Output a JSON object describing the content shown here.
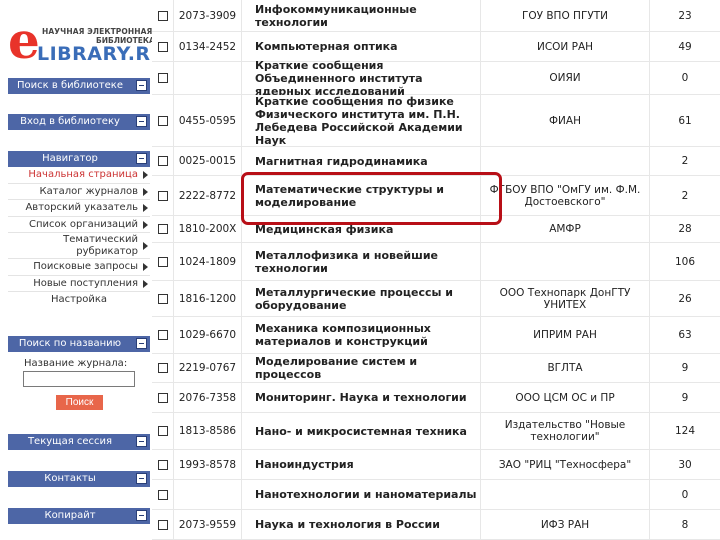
{
  "logo": {
    "line1": "НАУЧНАЯ ЭЛЕКТРОННАЯ",
    "line2": "БИБЛИОТЕКА",
    "main": "LIBRARY.RU",
    "letter": "e",
    "brand_color": "#e8332a",
    "blue": "#3a6db8"
  },
  "sidebar": {
    "search_library": "Поиск в библиотеке",
    "login": "Вход в библиотеку",
    "navigator": "Навигатор",
    "nav_items": [
      {
        "label": "Начальная страница",
        "active": true
      },
      {
        "label": "Каталог журналов",
        "active": false
      },
      {
        "label": "Авторский указатель",
        "active": false
      },
      {
        "label": "Список организаций",
        "active": false
      },
      {
        "label": "Тематический рубрикатор",
        "line1": "Тематический",
        "line2": "рубрикатор",
        "active": false
      },
      {
        "label": "Поисковые запросы",
        "active": false
      },
      {
        "label": "Новые поступления",
        "active": false
      }
    ],
    "settings": "Настройка",
    "search_by_name": "Поиск по названию",
    "journal_name_label": "Название журнала:",
    "journal_name_value": "",
    "search_button": "Поиск",
    "current_session": "Текущая сессия",
    "contacts": "Контакты",
    "kopirait": "Копирайт",
    "panel_color": "#4d66a6",
    "button_color": "#e8664a"
  },
  "journals": [
    {
      "issn": "2073-3909",
      "title": "Инфокоммуникационные технологии",
      "publisher": "ГОУ ВПО ПГУТИ",
      "count": "23"
    },
    {
      "issn": "0134-2452",
      "title": "Компьютерная оптика",
      "publisher": "ИСОИ РАН",
      "count": "49"
    },
    {
      "issn": "",
      "title": "Краткие сообщения Объединенного института ядерных исследований",
      "publisher": "ОИЯИ",
      "count": "0"
    },
    {
      "issn": "0455-0595",
      "title": "Краткие сообщения по физике Физического института им. П.Н. Лебедева Российской Академии Наук",
      "publisher": "ФИАН",
      "count": "61"
    },
    {
      "issn": "0025-0015",
      "title": "Магнитная гидродинамика",
      "publisher": "",
      "count": "2"
    },
    {
      "issn": "2222-8772",
      "title": "Математические структуры и моделирование",
      "publisher": "ФГБОУ ВПО \"ОмГУ им. Ф.М. Достоевского\"",
      "count": "2"
    },
    {
      "issn": "1810-200X",
      "title": "Медицинская физика",
      "publisher": "АМФР",
      "count": "28"
    },
    {
      "issn": "1024-1809",
      "title": "Металлофизика и новейшие технологии",
      "publisher": "",
      "count": "106"
    },
    {
      "issn": "1816-1200",
      "title": "Металлургические процессы и оборудование",
      "publisher": "ООО Технопарк ДонГТУ УНИТЕХ",
      "count": "26"
    },
    {
      "issn": "1029-6670",
      "title": "Механика композиционных материалов и конструкций",
      "publisher": "ИПРИМ РАН",
      "count": "63"
    },
    {
      "issn": "2219-0767",
      "title": "Моделирование систем и процессов",
      "publisher": "ВГЛТА",
      "count": "9"
    },
    {
      "issn": "2076-7358",
      "title": "Мониторинг. Наука и технологии",
      "publisher": "ООО ЦСМ ОС и ПР",
      "count": "9"
    },
    {
      "issn": "1813-8586",
      "title": "Нано- и микросистемная техника",
      "publisher": "Издательство \"Новые технологии\"",
      "count": "124"
    },
    {
      "issn": "1993-8578",
      "title": "Наноиндустрия",
      "publisher": "ЗАО \"РИЦ \"Техносфера\"",
      "count": "30"
    },
    {
      "issn": "",
      "title": "Нанотехнологии и наноматериалы",
      "publisher": "",
      "count": "0"
    },
    {
      "issn": "2073-9559",
      "title": "Наука и технология в России",
      "publisher": "ИФЗ РАН",
      "count": "8"
    }
  ],
  "highlight_color": "#b80f17"
}
